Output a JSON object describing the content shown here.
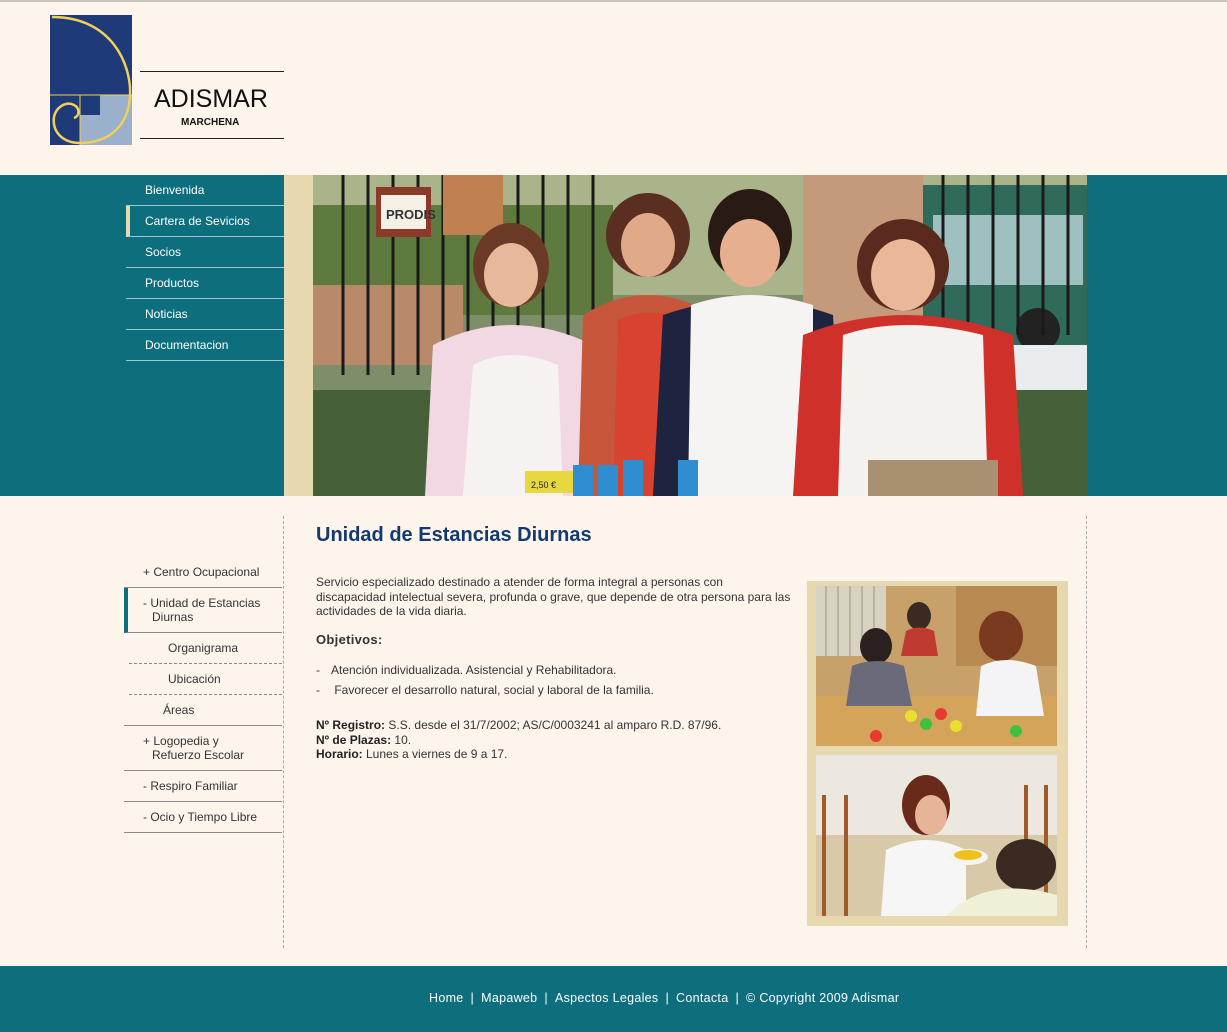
{
  "brand": {
    "name": "ADISMAR",
    "sub": "MARCHENA"
  },
  "top_nav": [
    {
      "label": "Bienvenida",
      "active": false
    },
    {
      "label": "Cartera de Sevicios",
      "active": true
    },
    {
      "label": "Socios",
      "active": false
    },
    {
      "label": "Productos",
      "active": false
    },
    {
      "label": "Noticias",
      "active": false
    },
    {
      "label": "Documentacion",
      "active": false
    }
  ],
  "banner": {
    "sign_text": "PRODIS",
    "price_tag": "2,50 €"
  },
  "side_nav": {
    "centro": "+ Centro Ocupacional",
    "unidad_l1": "- Unidad de Estancias",
    "unidad_l2": "Diurnas",
    "organigrama": "Organigrama",
    "ubicacion": "Ubicación",
    "areas": "Áreas",
    "logo_l1": "+ Logopedia y",
    "logo_l2": "Refuerzo Escolar",
    "respiro": "- Respiro Familiar",
    "ocio": "- Ocio y Tiempo Libre"
  },
  "main": {
    "title": "Unidad de Estancias Diurnas",
    "intro": "Servicio especializado destinado a atender de forma integral a personas con discapacidad intelectual severa, profunda o grave, que depende de otra persona para las actividades de la vida diaria.",
    "objectives_heading": "Objetivos:",
    "objectives": [
      "Atención individualizada. Asistencial y Rehabilitadora.",
      " Favorecer el desarrollo natural, social y laboral de la familia."
    ],
    "registro_label": "Nº  Registro:",
    "registro_value": " S.S. desde el 31/7/2002; AS/C/0003241 al amparo R.D. 87/96.",
    "plazas_label": "Nº de Plazas:",
    "plazas_value": " 10.",
    "horario_label": "Horario:",
    "horario_value": " Lunes a viernes de 9 a 17."
  },
  "footer": {
    "home": "Home",
    "mapa": "Mapaweb",
    "legales": "Aspectos Legales",
    "contacta": "Contacta",
    "copyright": "© Copyright 2009 Adismar",
    "separator": "|"
  },
  "colors": {
    "teal": "#0d6e7e",
    "cream": "#fdf5ec",
    "sand": "#e8d8b0",
    "navy": "#123a6e"
  }
}
